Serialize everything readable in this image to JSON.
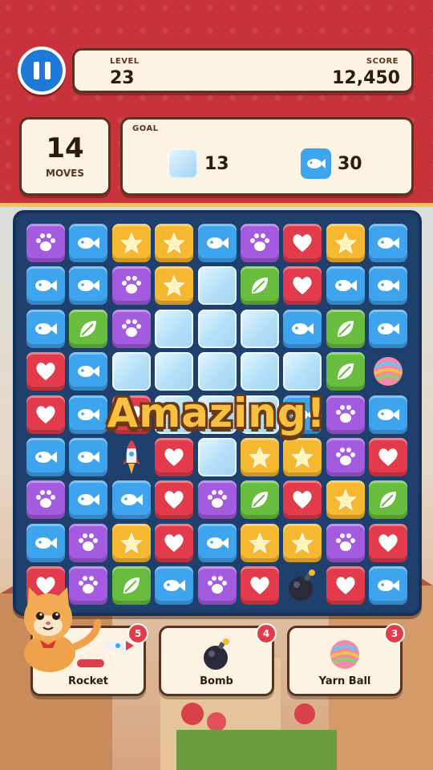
{
  "hud": {
    "level_label": "LEVEL",
    "level": "23",
    "score_label": "SCORE",
    "score": "12,450",
    "moves": "14",
    "moves_label": "MOVES",
    "goal_label": "GOAL",
    "goals": [
      {
        "icon": "ice-block-icon",
        "count": "13"
      },
      {
        "icon": "fish-tile-icon",
        "count": "30"
      }
    ]
  },
  "board": {
    "rows": 9,
    "cols": 9,
    "grid": [
      [
        "paw",
        "fish",
        "star",
        "star",
        "fish",
        "paw",
        "heart",
        "star",
        "fish"
      ],
      [
        "fish",
        "fish",
        "paw",
        "star",
        "ice",
        "leaf",
        "heart",
        "fish",
        "fish"
      ],
      [
        "fish",
        "leaf",
        "paw",
        "ice",
        "ice",
        "ice",
        "fish",
        "leaf",
        "fish"
      ],
      [
        "heart",
        "fish",
        "ice",
        "ice",
        "ice",
        "ice",
        "ice",
        "leaf",
        "yarn"
      ],
      [
        "heart",
        "fish",
        "heart",
        "ice",
        "ice",
        "ice",
        "fish",
        "paw",
        "fish"
      ],
      [
        "fish",
        "fish",
        "rocket",
        "heart",
        "ice",
        "star",
        "star",
        "paw",
        "heart"
      ],
      [
        "paw",
        "fish",
        "fish",
        "heart",
        "paw",
        "leaf",
        "heart",
        "star",
        "leaf"
      ],
      [
        "fish",
        "paw",
        "star",
        "heart",
        "fish",
        "star",
        "star",
        "paw",
        "heart"
      ],
      [
        "heart",
        "paw",
        "leaf",
        "fish",
        "paw",
        "heart",
        "bomb",
        "heart",
        "fish"
      ]
    ],
    "colors": {
      "paw": "#a45be0",
      "fish": "#3fa4ee",
      "star": "#f6b830",
      "heart": "#e23c4c",
      "leaf": "#68bd3e"
    }
  },
  "combo_text": "Amazing!",
  "boosters": [
    {
      "label": "Rocket",
      "count": "5",
      "icon": "rocket-icon"
    },
    {
      "label": "Bomb",
      "count": "4",
      "icon": "bomb-icon"
    },
    {
      "label": "Yarn Ball",
      "count": "3",
      "icon": "yarn-ball-icon"
    }
  ]
}
